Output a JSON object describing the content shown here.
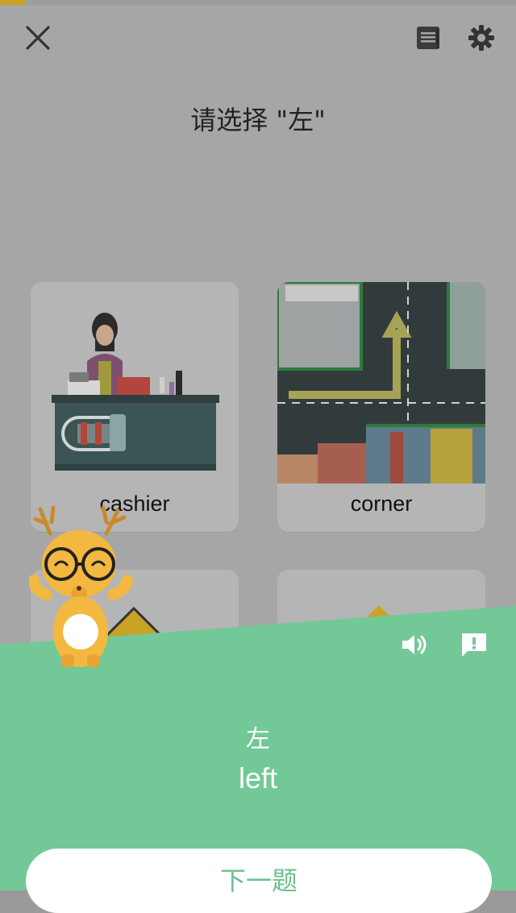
{
  "progress": 0.05,
  "prompt": "请选择 \"左\"",
  "cards": [
    {
      "label": "cashier"
    },
    {
      "label": "corner"
    },
    {
      "label": ""
    },
    {
      "label": ""
    }
  ],
  "result": {
    "word": "左",
    "meaning": "left",
    "next_label": "下一题"
  },
  "colors": {
    "accent_green": "#73c897",
    "progress_gold": "#c9a326"
  },
  "icons": {
    "close": "close-icon",
    "notes": "notes-icon",
    "settings": "gear-icon",
    "sound": "speaker-icon",
    "report": "report-icon"
  }
}
